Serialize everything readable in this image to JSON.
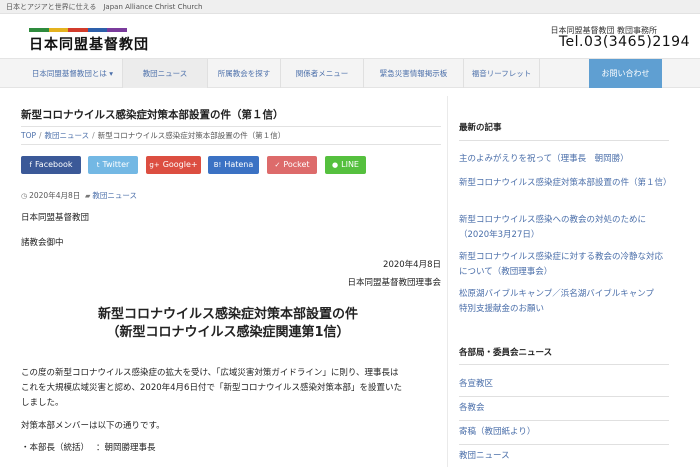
{
  "topbar": {
    "tagline": "日本とアジアと世界に仕える　Japan Alliance Christ Church"
  },
  "header": {
    "logo_text": "日本同盟基督教団",
    "logo_colors": [
      "#2e8b3d",
      "#e4b21e",
      "#d23b2b",
      "#2d5faa",
      "#7a3b9c"
    ],
    "office_label": "日本同盟基督教団 教団事務所",
    "tel": "Tel.03(3465)2194"
  },
  "nav": {
    "items": [
      "日本同盟基督教団とは ▾",
      "教団ニュース",
      "所属教会を探す",
      "関係者メニュー",
      "緊急災害情報掲示板",
      "福音リーフレット"
    ],
    "contact": "お問い合わせ"
  },
  "post": {
    "title": "新型コロナウイルス感染症対策本部設置の件（第１信）",
    "breadcrumb": [
      "TOP",
      "教団ニュース",
      "新型コロナウイルス感染症対策本部設置の件（第１信）"
    ],
    "share": [
      {
        "label": "Facebook",
        "icon": "f",
        "color": "#3b5998"
      },
      {
        "label": "Twitter",
        "icon": "t",
        "color": "#73b8e4"
      },
      {
        "label": "Google+",
        "icon": "g+",
        "color": "#dc4e41"
      },
      {
        "label": "Hatena",
        "icon": "B!",
        "color": "#3b72c4"
      },
      {
        "label": "Pocket",
        "icon": "✓",
        "color": "#dd6b6b"
      },
      {
        "label": "LINE",
        "icon": "●",
        "color": "#55c03e"
      }
    ],
    "date": "2020年4月8日",
    "category": "教団ニュース",
    "to_org": "日本同盟基督教団",
    "to_churches": "諸教会御中",
    "sent_date": "2020年4月8日",
    "from": "日本同盟基督教団理事会",
    "heading1": "新型コロナウイルス感染症対策本部設置の件",
    "heading2": "（新型コロナウイルス感染症関連第1信）",
    "para1": "この度の新型コロナウイルス感染症の拡大を受け、「広域災害対策ガイドライン」に則り、理事長は",
    "para2": "これを大規模広域災害と認め、2020年4月6日付で「新型コロナウイルス感染対策本部」を設置いた",
    "para3": "しました。",
    "members_intro": "対策本部メンバーは以下の通りです。",
    "member1": "・本部長（統括）　 ：朝岡勝理事長"
  },
  "sidebar": {
    "recent_heading": "最新の記事",
    "recent": [
      "主のよみがえりを祝って（理事長　朝岡勝）",
      "新型コロナウイルス感染症対策本部設置の件（第１信）",
      "新型コロナウイルス感染への教会の対処のために（2020年3月27日）",
      "新型コロナウイルス感染症に対する教会の冷静な対応について（教団理事会）",
      "松原湖バイブルキャンプ／浜名湖バイブルキャンプ　特別支援献金のお願い"
    ],
    "dept_heading": "各部局・委員会ニュース",
    "depts": [
      "各宣教区",
      "各教会",
      "寄稿（教団紙より）",
      "教団ニュース"
    ]
  }
}
